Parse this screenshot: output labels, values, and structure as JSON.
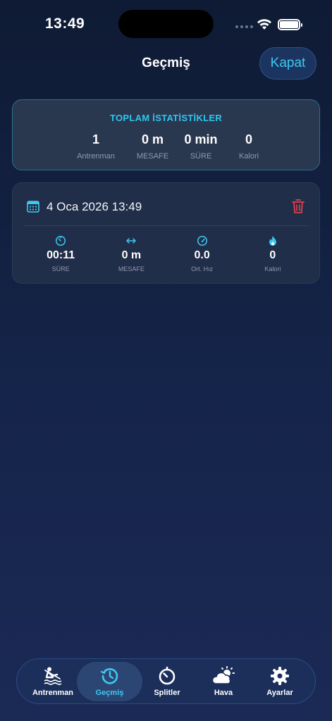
{
  "status_bar": {
    "time": "13:49"
  },
  "header": {
    "title": "Geçmiş",
    "close_label": "Kapat"
  },
  "totals": {
    "title": "TOPLAM İSTATİSTİKLER",
    "items": [
      {
        "value": "1",
        "label": "Antrenman"
      },
      {
        "value": "0 m",
        "label": "MESAFE"
      },
      {
        "value": "0 min",
        "label": "SÜRE"
      },
      {
        "value": "0",
        "label": "Kalori"
      }
    ]
  },
  "sessions": [
    {
      "date": "4 Oca 2026 13:49",
      "metrics": [
        {
          "icon": "timer-icon",
          "value": "00:11",
          "label": "SÜRE"
        },
        {
          "icon": "distance-arrows-icon",
          "value": "0 m",
          "label": "MESAFE"
        },
        {
          "icon": "speedometer-icon",
          "value": "0.0",
          "label": "Ort. Hız"
        },
        {
          "icon": "flame-icon",
          "value": "0",
          "label": "Kalori"
        }
      ]
    }
  ],
  "tab_bar": {
    "items": [
      {
        "label": "Antrenman",
        "icon": "rowing-icon"
      },
      {
        "label": "Geçmiş",
        "icon": "history-icon"
      },
      {
        "label": "Splitler",
        "icon": "stopwatch-icon"
      },
      {
        "label": "Hava",
        "icon": "weather-icon"
      },
      {
        "label": "Ayarlar",
        "icon": "gear-icon"
      }
    ],
    "active": "Geçmiş"
  },
  "colors": {
    "accent": "#3ec8f0",
    "danger": "#e0414c",
    "background": "#15244a"
  }
}
